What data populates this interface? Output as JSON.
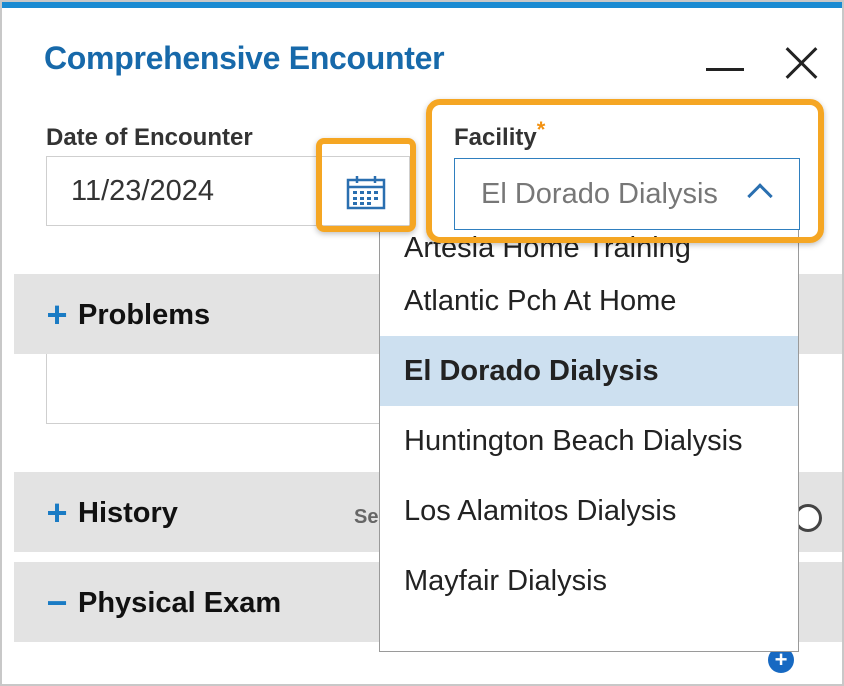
{
  "dialog": {
    "title": "Comprehensive Encounter"
  },
  "date_field": {
    "label": "Date of Encounter",
    "value": "11/23/2024"
  },
  "facility_field": {
    "label": "Facility",
    "required_mark": "*",
    "value": "El Dorado Dialysis",
    "options": [
      "Artesia Home Training",
      "Atlantic Pch At Home",
      "El Dorado Dialysis",
      "Huntington Beach Dialysis",
      "Los Alamitos Dialysis",
      "Mayfair Dialysis"
    ],
    "selected_index": 2
  },
  "sections": {
    "problems": {
      "label": "Problems",
      "sign": "+"
    },
    "history": {
      "label": "History",
      "sign": "+",
      "extra_text": "Se"
    },
    "physical_exam": {
      "label": "Physical Exam",
      "sign": "−"
    }
  },
  "colors": {
    "accent_blue": "#1769aa",
    "highlight_orange": "#f5a623",
    "selected_row": "#cde0f0"
  }
}
